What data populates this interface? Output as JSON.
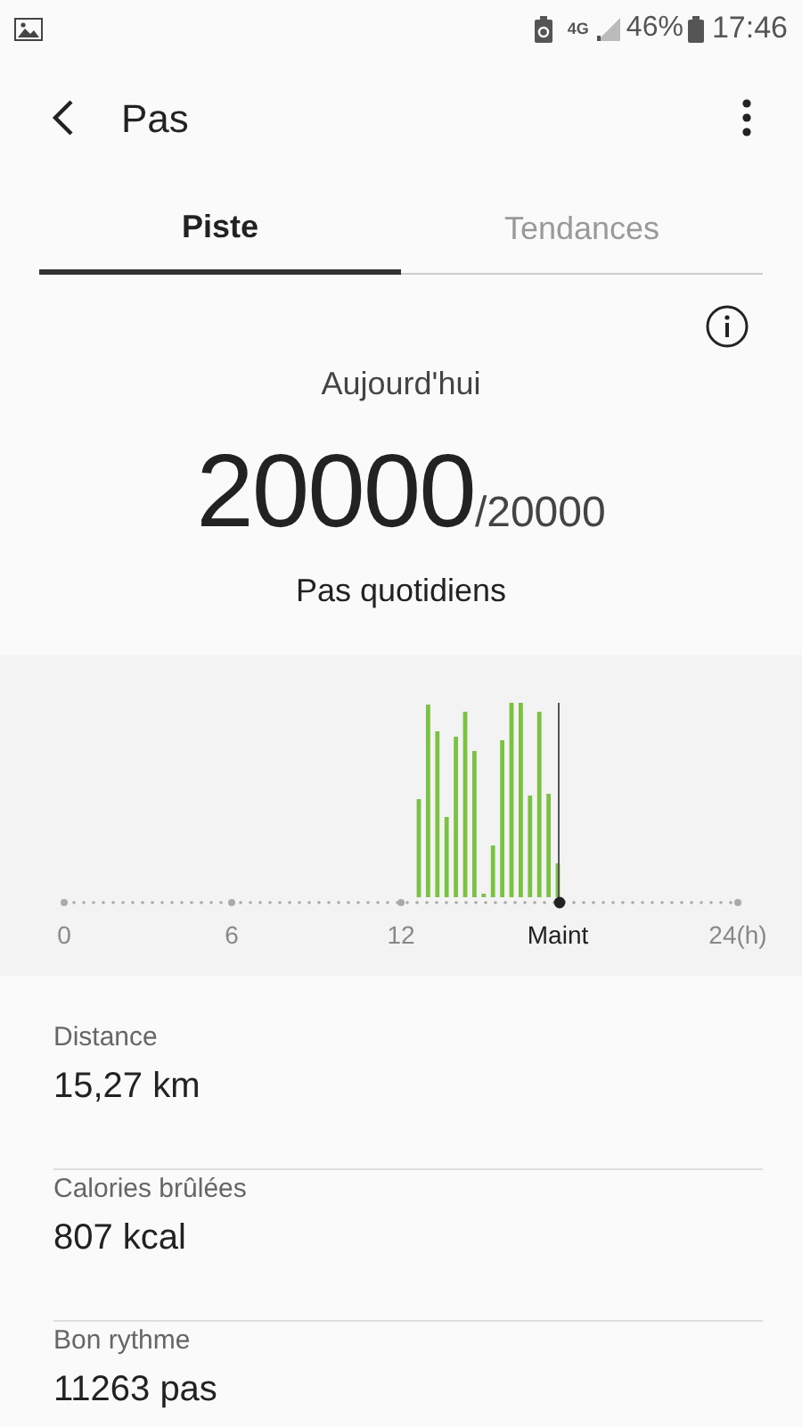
{
  "status_bar": {
    "battery": "46%",
    "time": "17:46",
    "network": "4G"
  },
  "header": {
    "title": "Pas"
  },
  "tabs": [
    {
      "label": "Piste",
      "selected": true
    },
    {
      "label": "Tendances",
      "selected": false
    }
  ],
  "summary": {
    "caption": "Aujourd'hui",
    "value": "20000",
    "goal": "/20000",
    "subtitle": "Pas quotidiens"
  },
  "chart": {
    "x_labels": [
      {
        "label": "0",
        "now": false
      },
      {
        "label": "6",
        "now": false
      },
      {
        "label": "12",
        "now": false
      },
      {
        "label": "Maint",
        "now": true
      },
      {
        "label": "24(h)",
        "now": false
      }
    ]
  },
  "stats": [
    {
      "label": "Distance",
      "value": "15,27 km"
    },
    {
      "label": "Calories brûlées",
      "value": "807 kcal"
    },
    {
      "label": "Bon rythme",
      "value": "11263 pas"
    }
  ]
}
